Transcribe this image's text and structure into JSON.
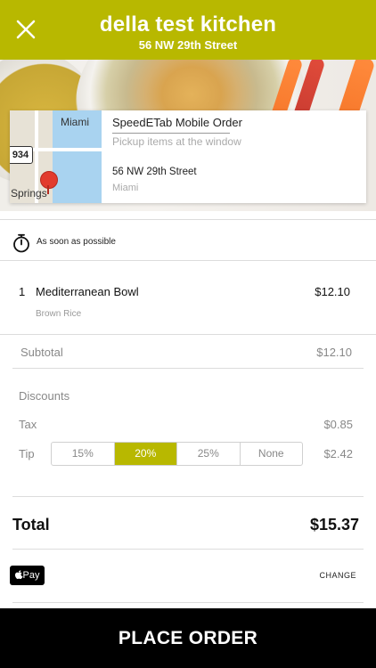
{
  "header": {
    "title": "della test kitchen",
    "subtitle": "56 NW 29th Street",
    "bg_color": "#b8b800"
  },
  "card": {
    "title": "SpeedETab Mobile Order",
    "subtitle": "Pickup items at the window",
    "address": "56 NW 29th Street",
    "city": "Miami",
    "map": {
      "label_city": "Miami",
      "label_area": "Springs",
      "shield": "934"
    }
  },
  "timing": {
    "label": "As soon as possible",
    "icon": "stopwatch-icon"
  },
  "items": [
    {
      "qty": "1",
      "name": "Mediterranean Bowl",
      "price": "$12.10",
      "modifier": "Brown Rice"
    }
  ],
  "summary": {
    "subtotal_label": "Subtotal",
    "subtotal": "$12.10",
    "discounts_label": "Discounts",
    "tax_label": "Tax",
    "tax": "$0.85",
    "tip_label": "Tip",
    "tip": "$2.42",
    "tip_options": [
      "15%",
      "20%",
      "25%",
      "None"
    ],
    "tip_selected": "20%",
    "total_label": "Total",
    "total": "$15.37"
  },
  "payment": {
    "method": "Pay",
    "change_label": "CHANGE"
  },
  "place_order_label": "PLACE ORDER"
}
